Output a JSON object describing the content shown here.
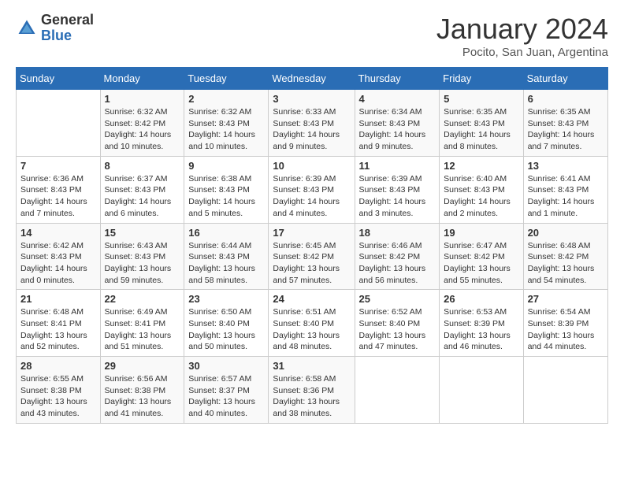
{
  "logo": {
    "general": "General",
    "blue": "Blue"
  },
  "header": {
    "month": "January 2024",
    "location": "Pocito, San Juan, Argentina"
  },
  "weekdays": [
    "Sunday",
    "Monday",
    "Tuesday",
    "Wednesday",
    "Thursday",
    "Friday",
    "Saturday"
  ],
  "weeks": [
    [
      {
        "day": "",
        "info": ""
      },
      {
        "day": "1",
        "info": "Sunrise: 6:32 AM\nSunset: 8:42 PM\nDaylight: 14 hours\nand 10 minutes."
      },
      {
        "day": "2",
        "info": "Sunrise: 6:32 AM\nSunset: 8:43 PM\nDaylight: 14 hours\nand 10 minutes."
      },
      {
        "day": "3",
        "info": "Sunrise: 6:33 AM\nSunset: 8:43 PM\nDaylight: 14 hours\nand 9 minutes."
      },
      {
        "day": "4",
        "info": "Sunrise: 6:34 AM\nSunset: 8:43 PM\nDaylight: 14 hours\nand 9 minutes."
      },
      {
        "day": "5",
        "info": "Sunrise: 6:35 AM\nSunset: 8:43 PM\nDaylight: 14 hours\nand 8 minutes."
      },
      {
        "day": "6",
        "info": "Sunrise: 6:35 AM\nSunset: 8:43 PM\nDaylight: 14 hours\nand 7 minutes."
      }
    ],
    [
      {
        "day": "7",
        "info": "Sunrise: 6:36 AM\nSunset: 8:43 PM\nDaylight: 14 hours\nand 7 minutes."
      },
      {
        "day": "8",
        "info": "Sunrise: 6:37 AM\nSunset: 8:43 PM\nDaylight: 14 hours\nand 6 minutes."
      },
      {
        "day": "9",
        "info": "Sunrise: 6:38 AM\nSunset: 8:43 PM\nDaylight: 14 hours\nand 5 minutes."
      },
      {
        "day": "10",
        "info": "Sunrise: 6:39 AM\nSunset: 8:43 PM\nDaylight: 14 hours\nand 4 minutes."
      },
      {
        "day": "11",
        "info": "Sunrise: 6:39 AM\nSunset: 8:43 PM\nDaylight: 14 hours\nand 3 minutes."
      },
      {
        "day": "12",
        "info": "Sunrise: 6:40 AM\nSunset: 8:43 PM\nDaylight: 14 hours\nand 2 minutes."
      },
      {
        "day": "13",
        "info": "Sunrise: 6:41 AM\nSunset: 8:43 PM\nDaylight: 14 hours\nand 1 minute."
      }
    ],
    [
      {
        "day": "14",
        "info": "Sunrise: 6:42 AM\nSunset: 8:43 PM\nDaylight: 14 hours\nand 0 minutes."
      },
      {
        "day": "15",
        "info": "Sunrise: 6:43 AM\nSunset: 8:43 PM\nDaylight: 13 hours\nand 59 minutes."
      },
      {
        "day": "16",
        "info": "Sunrise: 6:44 AM\nSunset: 8:43 PM\nDaylight: 13 hours\nand 58 minutes."
      },
      {
        "day": "17",
        "info": "Sunrise: 6:45 AM\nSunset: 8:42 PM\nDaylight: 13 hours\nand 57 minutes."
      },
      {
        "day": "18",
        "info": "Sunrise: 6:46 AM\nSunset: 8:42 PM\nDaylight: 13 hours\nand 56 minutes."
      },
      {
        "day": "19",
        "info": "Sunrise: 6:47 AM\nSunset: 8:42 PM\nDaylight: 13 hours\nand 55 minutes."
      },
      {
        "day": "20",
        "info": "Sunrise: 6:48 AM\nSunset: 8:42 PM\nDaylight: 13 hours\nand 54 minutes."
      }
    ],
    [
      {
        "day": "21",
        "info": "Sunrise: 6:48 AM\nSunset: 8:41 PM\nDaylight: 13 hours\nand 52 minutes."
      },
      {
        "day": "22",
        "info": "Sunrise: 6:49 AM\nSunset: 8:41 PM\nDaylight: 13 hours\nand 51 minutes."
      },
      {
        "day": "23",
        "info": "Sunrise: 6:50 AM\nSunset: 8:40 PM\nDaylight: 13 hours\nand 50 minutes."
      },
      {
        "day": "24",
        "info": "Sunrise: 6:51 AM\nSunset: 8:40 PM\nDaylight: 13 hours\nand 48 minutes."
      },
      {
        "day": "25",
        "info": "Sunrise: 6:52 AM\nSunset: 8:40 PM\nDaylight: 13 hours\nand 47 minutes."
      },
      {
        "day": "26",
        "info": "Sunrise: 6:53 AM\nSunset: 8:39 PM\nDaylight: 13 hours\nand 46 minutes."
      },
      {
        "day": "27",
        "info": "Sunrise: 6:54 AM\nSunset: 8:39 PM\nDaylight: 13 hours\nand 44 minutes."
      }
    ],
    [
      {
        "day": "28",
        "info": "Sunrise: 6:55 AM\nSunset: 8:38 PM\nDaylight: 13 hours\nand 43 minutes."
      },
      {
        "day": "29",
        "info": "Sunrise: 6:56 AM\nSunset: 8:38 PM\nDaylight: 13 hours\nand 41 minutes."
      },
      {
        "day": "30",
        "info": "Sunrise: 6:57 AM\nSunset: 8:37 PM\nDaylight: 13 hours\nand 40 minutes."
      },
      {
        "day": "31",
        "info": "Sunrise: 6:58 AM\nSunset: 8:36 PM\nDaylight: 13 hours\nand 38 minutes."
      },
      {
        "day": "",
        "info": ""
      },
      {
        "day": "",
        "info": ""
      },
      {
        "day": "",
        "info": ""
      }
    ]
  ]
}
